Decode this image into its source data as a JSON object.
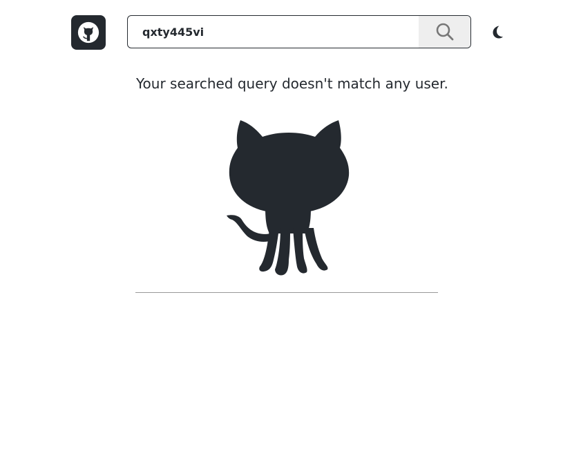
{
  "header": {
    "logo_icon": "github-octocat-icon",
    "search": {
      "value": "qxty445vi",
      "placeholder": "",
      "button_icon": "search-icon"
    },
    "theme_toggle_icon": "moon-icon"
  },
  "main": {
    "message": "Your searched query doesn't match any user.",
    "illustration_icon": "octocat-illustration"
  },
  "colors": {
    "foreground": "#24292f",
    "background": "#ffffff",
    "search_button_bg": "#eeeeee",
    "divider": "#999999"
  }
}
